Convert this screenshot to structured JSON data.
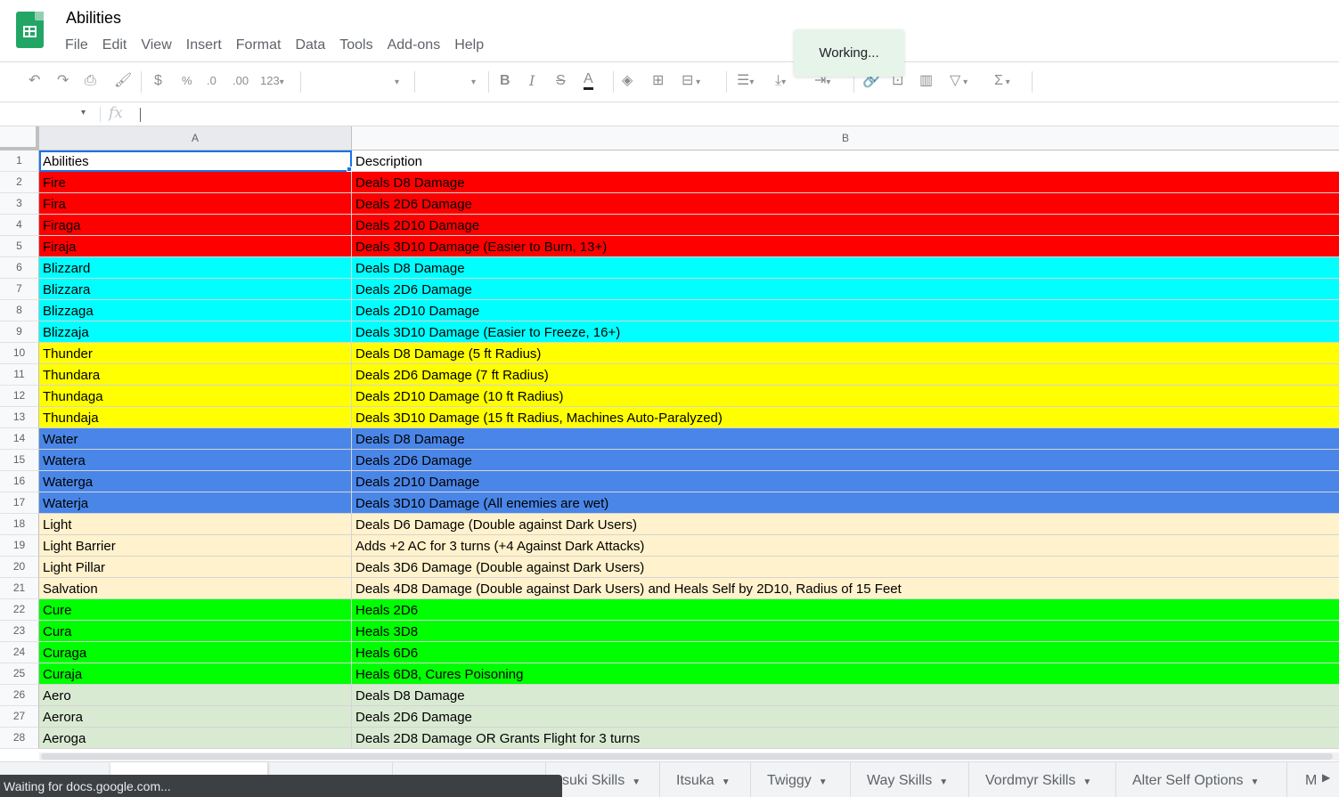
{
  "app": {
    "title": "Abilities",
    "menu": [
      "File",
      "Edit",
      "View",
      "Insert",
      "Format",
      "Data",
      "Tools",
      "Add-ons",
      "Help"
    ],
    "toast": "Working..."
  },
  "toolbar": {
    "zoom_format": "123",
    "currency": "$",
    "percent": "%",
    "decrease_decimal": ".0",
    "increase_decimal": ".00",
    "sum": "Σ"
  },
  "formula_bar": {
    "fx": "fx",
    "value": ""
  },
  "columns": [
    {
      "letter": "A",
      "header": "Abilities"
    },
    {
      "letter": "B",
      "header": "Description"
    }
  ],
  "rows": [
    {
      "num": "1",
      "a": "Abilities",
      "b": "Description",
      "color": "#ffffff"
    },
    {
      "num": "2",
      "a": "Fire",
      "b": "Deals D8 Damage",
      "color": "#ff0000"
    },
    {
      "num": "3",
      "a": "Fira",
      "b": "Deals 2D6 Damage",
      "color": "#ff0000"
    },
    {
      "num": "4",
      "a": "Firaga",
      "b": "Deals 2D10 Damage",
      "color": "#ff0000"
    },
    {
      "num": "5",
      "a": "Firaja",
      "b": "Deals 3D10 Damage (Easier to Burn, 13+)",
      "color": "#ff0000"
    },
    {
      "num": "6",
      "a": "Blizzard",
      "b": "Deals D8 Damage",
      "color": "#00ffff"
    },
    {
      "num": "7",
      "a": "Blizzara",
      "b": "Deals 2D6 Damage",
      "color": "#00ffff"
    },
    {
      "num": "8",
      "a": "Blizzaga",
      "b": "Deals 2D10 Damage",
      "color": "#00ffff"
    },
    {
      "num": "9",
      "a": "Blizzaja",
      "b": "Deals 3D10 Damage (Easier to Freeze, 16+)",
      "color": "#00ffff"
    },
    {
      "num": "10",
      "a": "Thunder",
      "b": "Deals D8 Damage (5 ft Radius)",
      "color": "#ffff00"
    },
    {
      "num": "11",
      "a": "Thundara",
      "b": "Deals 2D6 Damage (7 ft Radius)",
      "color": "#ffff00"
    },
    {
      "num": "12",
      "a": "Thundaga",
      "b": "Deals 2D10 Damage (10 ft Radius)",
      "color": "#ffff00"
    },
    {
      "num": "13",
      "a": "Thundaja",
      "b": "Deals 3D10 Damage (15 ft Radius, Machines Auto-Paralyzed)",
      "color": "#ffff00"
    },
    {
      "num": "14",
      "a": "Water",
      "b": "Deals D8 Damage",
      "color": "#4a86e8"
    },
    {
      "num": "15",
      "a": "Watera",
      "b": "Deals 2D6 Damage",
      "color": "#4a86e8"
    },
    {
      "num": "16",
      "a": "Waterga",
      "b": "Deals 2D10 Damage",
      "color": "#4a86e8"
    },
    {
      "num": "17",
      "a": "Waterja",
      "b": "Deals 3D10 Damage (All enemies are wet)",
      "color": "#4a86e8"
    },
    {
      "num": "18",
      "a": "Light",
      "b": "Deals D6 Damage (Double against Dark Users)",
      "color": "#fff2cc"
    },
    {
      "num": "19",
      "a": "Light Barrier",
      "b": "Adds +2 AC for 3 turns (+4 Against Dark Attacks)",
      "color": "#fff2cc"
    },
    {
      "num": "20",
      "a": "Light Pillar",
      "b": "Deals 3D6 Damage (Double against Dark Users)",
      "color": "#fff2cc"
    },
    {
      "num": "21",
      "a": "Salvation",
      "b": "Deals 4D8 Damage (Double against Dark Users) and Heals Self by 2D10, Radius of 15 Feet",
      "color": "#fff2cc"
    },
    {
      "num": "22",
      "a": "Cure",
      "b": "Heals 2D6",
      "color": "#00ff00"
    },
    {
      "num": "23",
      "a": "Cura",
      "b": "Heals 3D8",
      "color": "#00ff00"
    },
    {
      "num": "24",
      "a": "Curaga",
      "b": "Heals 6D6",
      "color": "#00ff00"
    },
    {
      "num": "25",
      "a": "Curaja",
      "b": "Heals 6D8, Cures Poisoning",
      "color": "#00ff00"
    },
    {
      "num": "26",
      "a": "Aero",
      "b": "Deals D8 Damage",
      "color": "#d9ead3"
    },
    {
      "num": "27",
      "a": "Aerora",
      "b": "Deals 2D6 Damage",
      "color": "#d9ead3"
    },
    {
      "num": "28",
      "a": "Aeroga",
      "b": "Deals 2D8 Damage OR Grants Flight for 3 turns",
      "color": "#d9ead3"
    }
  ],
  "sheet_tabs": [
    "suki Skills",
    "Itsuka",
    "Twiggy",
    "Way Skills",
    "Vordmyr Skills",
    "Alter Self Options",
    "M"
  ],
  "status_bar": "Waiting for docs.google.com..."
}
